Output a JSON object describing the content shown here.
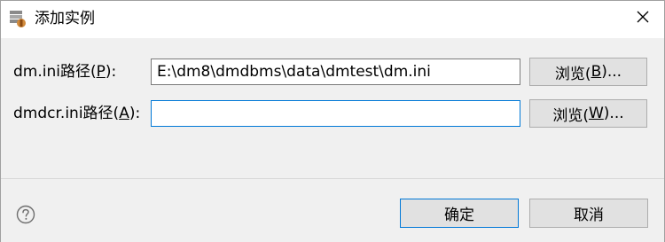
{
  "window": {
    "title": "添加实例",
    "app_icon": "app-icon",
    "close_icon": "close-icon"
  },
  "form": {
    "ini_label": "dm.ini路径(",
    "ini_label_mnemonic": "P",
    "ini_label_suffix": "):",
    "ini_value": "E:\\dm8\\dmdbms\\data\\dmtest\\dm.ini",
    "ini_browse_prefix": "浏览(",
    "ini_browse_mnemonic": "B",
    "ini_browse_suffix": ")...",
    "dcr_label": "dmdcr.ini路径(",
    "dcr_label_mnemonic": "A",
    "dcr_label_suffix": "):",
    "dcr_value": "",
    "dcr_browse_prefix": "浏览(",
    "dcr_browse_mnemonic": "W",
    "dcr_browse_suffix": ")..."
  },
  "footer": {
    "help_icon": "help-icon",
    "ok_label": "确定",
    "cancel_label": "取消"
  }
}
